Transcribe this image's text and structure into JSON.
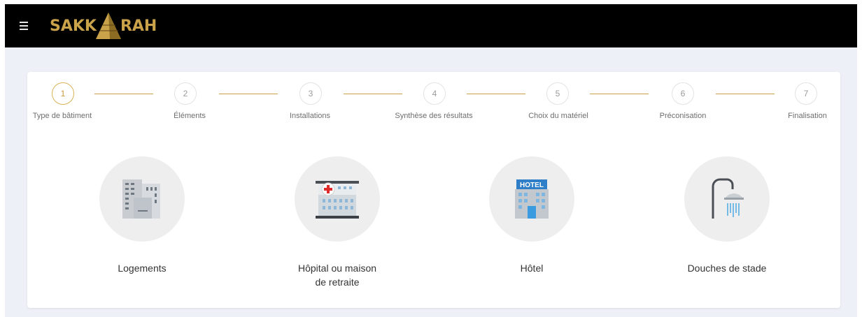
{
  "app": {
    "logo_left": "SAKK",
    "logo_right": "RAH"
  },
  "stepper": {
    "steps": [
      {
        "number": "1",
        "label": "Type de bâtiment",
        "active": true
      },
      {
        "number": "2",
        "label": "Éléments",
        "active": false
      },
      {
        "number": "3",
        "label": "Installations",
        "active": false
      },
      {
        "number": "4",
        "label": "Synthèse des résultats",
        "active": false
      },
      {
        "number": "5",
        "label": "Choix du matériel",
        "active": false
      },
      {
        "number": "6",
        "label": "Préconisation",
        "active": false
      },
      {
        "number": "7",
        "label": "Finalisation",
        "active": false
      }
    ]
  },
  "building_types": [
    {
      "label": "Logements",
      "icon": "apartment-building-icon"
    },
    {
      "label": "Hôpital ou maison de retraite",
      "icon": "hospital-icon"
    },
    {
      "label": "Hôtel",
      "icon": "hotel-icon",
      "sign": "HOTEL"
    },
    {
      "label": "Douches de stade",
      "icon": "shower-icon"
    }
  ],
  "colors": {
    "appbar": "#000000",
    "logo_gold": "#c9a24a",
    "accent": "#d9b256",
    "background": "#eef0f8",
    "clipped_text": "#2a8fd0"
  }
}
